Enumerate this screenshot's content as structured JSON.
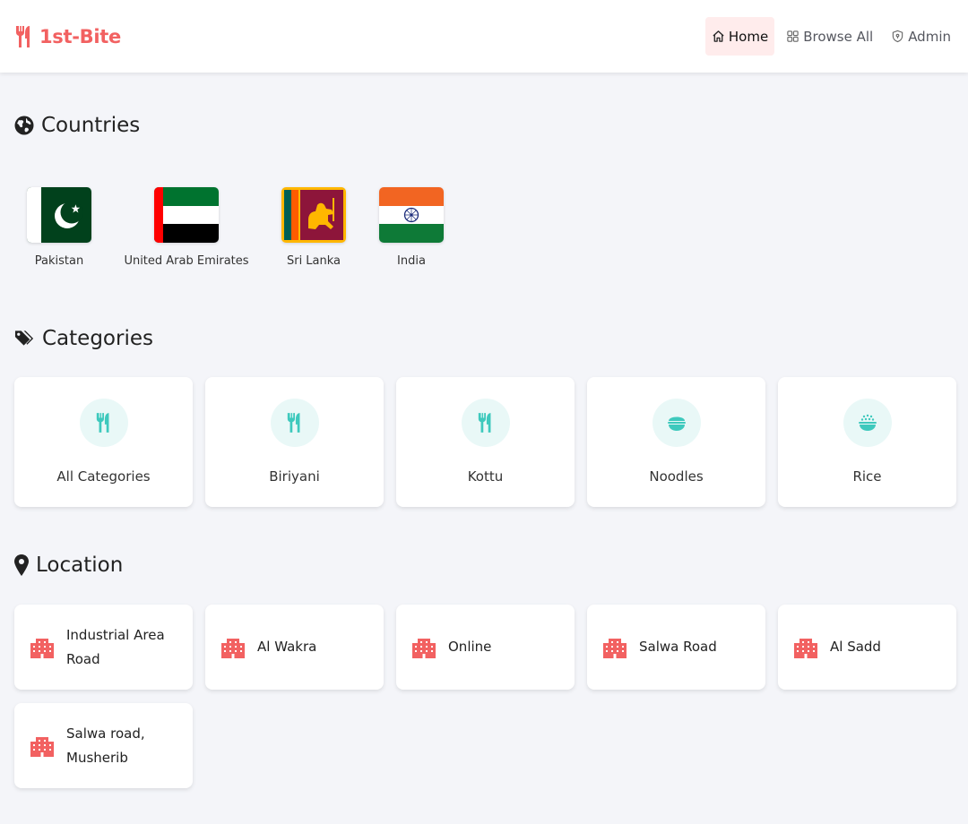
{
  "brand": {
    "name": "1st-Bite",
    "color": "#f26161",
    "icon": "utensils-icon"
  },
  "nav": {
    "items": [
      {
        "label": "Home",
        "icon": "home-icon",
        "active": true
      },
      {
        "label": "Browse All",
        "icon": "grid-icon",
        "active": false
      },
      {
        "label": "Admin",
        "icon": "shield-icon",
        "active": false
      }
    ]
  },
  "countries": {
    "title": "Countries",
    "icon": "globe-icon",
    "items": [
      {
        "name": "Pakistan",
        "flag": "pakistan-flag"
      },
      {
        "name": "United Arab Emirates",
        "flag": "uae-flag"
      },
      {
        "name": "Sri Lanka",
        "flag": "sri-lanka-flag"
      },
      {
        "name": "India",
        "flag": "india-flag"
      }
    ]
  },
  "categories": {
    "title": "Categories",
    "icon": "tags-icon",
    "accent": "#3ec9bd",
    "items": [
      {
        "label": "All Categories",
        "icon": "utensils-icon"
      },
      {
        "label": "Biriyani",
        "icon": "utensils-icon"
      },
      {
        "label": "Kottu",
        "icon": "utensils-icon"
      },
      {
        "label": "Noodles",
        "icon": "bowl-icon"
      },
      {
        "label": "Rice",
        "icon": "rice-bowl-icon"
      }
    ]
  },
  "locations": {
    "title": "Location",
    "icon": "map-pin-icon",
    "accent": "#f26161",
    "items": [
      {
        "label": "Industrial Area Road",
        "icon": "building-icon"
      },
      {
        "label": "Al Wakra",
        "icon": "building-icon"
      },
      {
        "label": "Online",
        "icon": "building-icon"
      },
      {
        "label": "Salwa Road",
        "icon": "building-icon"
      },
      {
        "label": "Al Sadd",
        "icon": "building-icon"
      },
      {
        "label": "Salwa road, Musherib",
        "icon": "building-icon"
      }
    ]
  }
}
